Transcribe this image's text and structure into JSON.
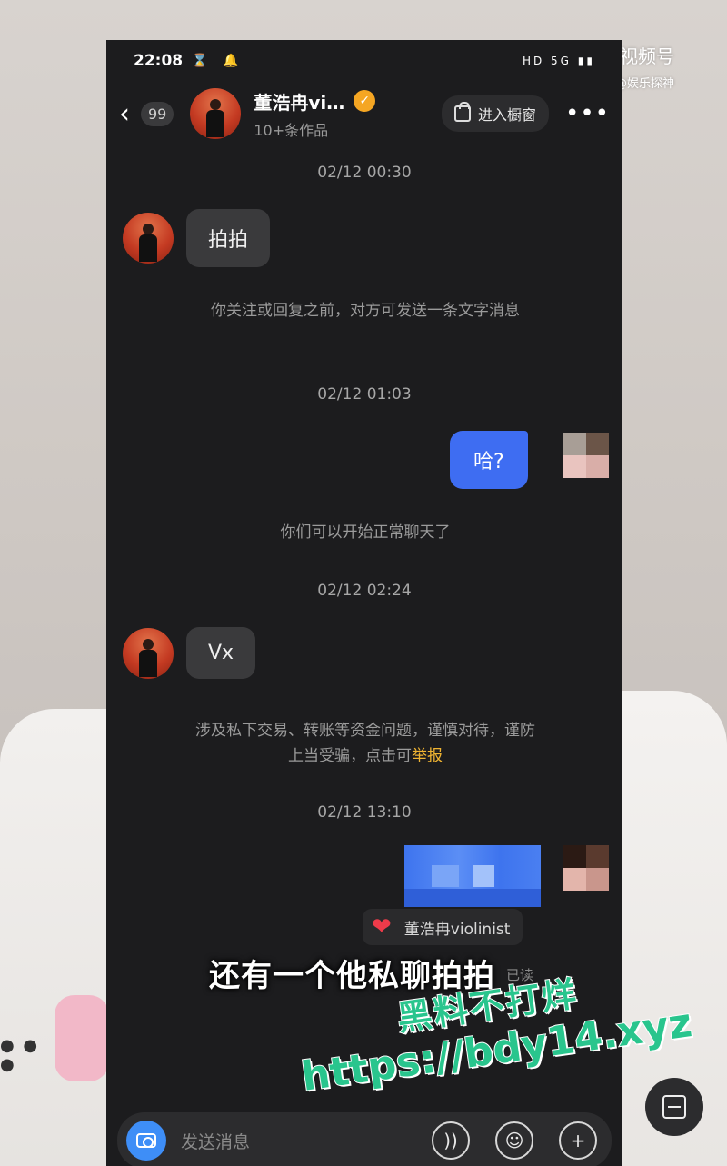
{
  "status_bar": {
    "time": "22:08",
    "left_icons": "⌛ 🔔",
    "right_icons": "HD 5G ▮▮"
  },
  "watermark": {
    "platform": "微博视频号",
    "handle": "@娱乐探神"
  },
  "header": {
    "back_count": "99",
    "name": "董浩冉vi…",
    "subtitle": "10+条作品",
    "shop_button": "进入橱窗",
    "more": "•••"
  },
  "messages": {
    "t1": "02/12 00:30",
    "m1": "拍拍",
    "sys1": "你关注或回复之前，对方可发送一条文字消息",
    "t2": "02/12 01:03",
    "m2": "哈?",
    "sys2": "你们可以开始正常聊天了",
    "t3": "02/12 02:24",
    "m3": "Vx",
    "sys3_a": "涉及私下交易、转账等资金问题，谨慎对待，谨防上当受骗，点击可",
    "sys3_report": "举报",
    "t4": "02/12 13:10",
    "reaction_name": "董浩冉violinist",
    "read_label": "已读"
  },
  "input": {
    "placeholder": "发送消息"
  },
  "caption": "还有一个他私聊拍拍",
  "overlay": {
    "line1": "黑料不打烊",
    "line2": "https://bdy14.xyz"
  },
  "colors": {
    "accent_blue": "#3e6df2",
    "report": "#f0b432",
    "overlay_green": "#29c58d"
  }
}
